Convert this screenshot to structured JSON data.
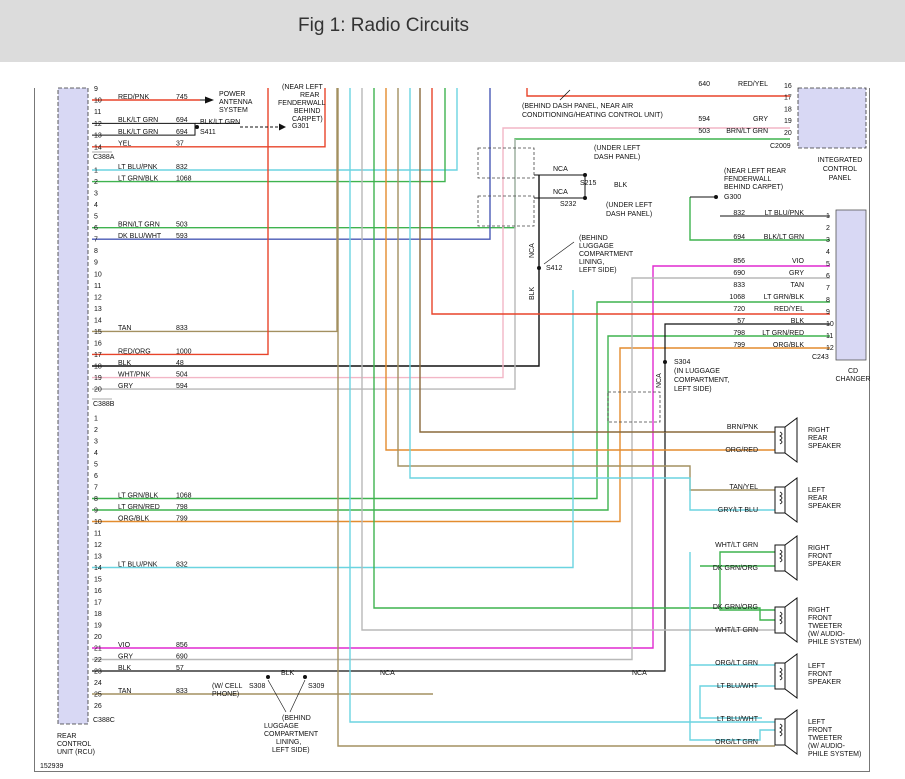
{
  "title": "Fig 1: Radio Circuits",
  "figure_id": "152939",
  "colors": {
    "connector_fill": "#d8d8f4",
    "wire_red": "#e8442a",
    "wire_green": "#3fb34f",
    "wire_cyan": "#6bd4e0",
    "wire_blue": "#4a5ab6",
    "wire_olive": "#a39060",
    "wire_orange": "#e38c2e",
    "wire_magenta": "#e02ad0",
    "wire_pink": "#f2b6c6",
    "wire_gray": "#b8b8b8",
    "wire_black": "#111111",
    "wire_brown": "#8a6a3c"
  },
  "rcu": {
    "label_1": "REAR",
    "label_2": "CONTROL",
    "label_3": "UNIT (RCU)",
    "connectors": [
      "C388A",
      "C388B",
      "C388C"
    ]
  },
  "rcu_a_pins": [
    {
      "pin": "9",
      "color": "",
      "circuit": ""
    },
    {
      "pin": "10",
      "color": "RED/PNK",
      "circuit": "745"
    },
    {
      "pin": "11",
      "color": "",
      "circuit": ""
    },
    {
      "pin": "12",
      "color": "BLK/LT GRN",
      "circuit": "694"
    },
    {
      "pin": "13",
      "color": "BLK/LT GRN",
      "circuit": "694"
    },
    {
      "pin": "14",
      "color": "YEL",
      "circuit": "37"
    }
  ],
  "rcu_b_pins": [
    {
      "pin": "1",
      "color": "LT BLU/PNK",
      "circuit": "832"
    },
    {
      "pin": "2",
      "color": "LT GRN/BLK",
      "circuit": "1068"
    },
    {
      "pin": "3",
      "color": "",
      "circuit": ""
    },
    {
      "pin": "4",
      "color": "",
      "circuit": ""
    },
    {
      "pin": "5",
      "color": "",
      "circuit": ""
    },
    {
      "pin": "6",
      "color": "BRN/LT GRN",
      "circuit": "503"
    },
    {
      "pin": "7",
      "color": "DK BLU/WHT",
      "circuit": "593"
    },
    {
      "pin": "8",
      "color": "",
      "circuit": ""
    },
    {
      "pin": "9",
      "color": "",
      "circuit": ""
    },
    {
      "pin": "10",
      "color": "",
      "circuit": ""
    },
    {
      "pin": "11",
      "color": "",
      "circuit": ""
    },
    {
      "pin": "12",
      "color": "",
      "circuit": ""
    },
    {
      "pin": "13",
      "color": "",
      "circuit": ""
    },
    {
      "pin": "14",
      "color": "",
      "circuit": ""
    },
    {
      "pin": "15",
      "color": "TAN",
      "circuit": "833"
    },
    {
      "pin": "16",
      "color": "",
      "circuit": ""
    },
    {
      "pin": "17",
      "color": "RED/ORG",
      "circuit": "1000"
    },
    {
      "pin": "18",
      "color": "BLK",
      "circuit": "48"
    },
    {
      "pin": "19",
      "color": "WHT/PNK",
      "circuit": "504"
    },
    {
      "pin": "20",
      "color": "GRY",
      "circuit": "594"
    }
  ],
  "rcu_c_pins": [
    {
      "pin": "1",
      "color": "",
      "circuit": ""
    },
    {
      "pin": "2",
      "color": "",
      "circuit": ""
    },
    {
      "pin": "3",
      "color": "",
      "circuit": ""
    },
    {
      "pin": "4",
      "color": "",
      "circuit": ""
    },
    {
      "pin": "5",
      "color": "",
      "circuit": ""
    },
    {
      "pin": "6",
      "color": "",
      "circuit": ""
    },
    {
      "pin": "7",
      "color": "",
      "circuit": ""
    },
    {
      "pin": "8",
      "color": "LT GRN/BLK",
      "circuit": "1068"
    },
    {
      "pin": "9",
      "color": "LT GRN/RED",
      "circuit": "798"
    },
    {
      "pin": "10",
      "color": "ORG/BLK",
      "circuit": "799"
    },
    {
      "pin": "11",
      "color": "",
      "circuit": ""
    },
    {
      "pin": "12",
      "color": "",
      "circuit": ""
    },
    {
      "pin": "13",
      "color": "",
      "circuit": ""
    },
    {
      "pin": "14",
      "color": "LT BLU/PNK",
      "circuit": "832"
    },
    {
      "pin": "15",
      "color": "",
      "circuit": ""
    },
    {
      "pin": "16",
      "color": "",
      "circuit": ""
    },
    {
      "pin": "17",
      "color": "",
      "circuit": ""
    },
    {
      "pin": "18",
      "color": "",
      "circuit": ""
    },
    {
      "pin": "19",
      "color": "",
      "circuit": ""
    },
    {
      "pin": "20",
      "color": "",
      "circuit": ""
    },
    {
      "pin": "21",
      "color": "VIO",
      "circuit": "856"
    },
    {
      "pin": "22",
      "color": "GRY",
      "circuit": "690"
    },
    {
      "pin": "23",
      "color": "BLK",
      "circuit": "57"
    },
    {
      "pin": "24",
      "color": "",
      "circuit": ""
    },
    {
      "pin": "25",
      "color": "TAN",
      "circuit": "833"
    },
    {
      "pin": "26",
      "color": "",
      "circuit": ""
    }
  ],
  "antenna": {
    "line1": "POWER",
    "line2": "ANTENNA",
    "line3": "SYSTEM"
  },
  "s411": {
    "label": "S411",
    "color": "BLK/LT GRN"
  },
  "g301": {
    "label": "G301",
    "note1": "(NEAR LEFT",
    "note2": "REAR",
    "note3": "FENDERWALL",
    "note4": "BEHIND",
    "note5": "CARPET)"
  },
  "icp": {
    "connector": "C2009",
    "label1": "INTEGRATED",
    "label2": "CONTROL",
    "label3": "PANEL",
    "pins": [
      {
        "pin": "16",
        "color": "RED/YEL",
        "circuit": "640"
      },
      {
        "pin": "17",
        "color": "",
        "circuit": ""
      },
      {
        "pin": "18",
        "color": "",
        "circuit": ""
      },
      {
        "pin": "19",
        "color": "GRY",
        "circuit": "594"
      },
      {
        "pin": "20",
        "color": "BRN/LT GRN",
        "circuit": "503"
      }
    ],
    "note1": "(BEHIND DASH PANEL, NEAR AIR",
    "note2": "CONDITIONING/HEATING CONTROL UNIT)"
  },
  "splices": {
    "s215": {
      "label": "S215",
      "nca": "NCA",
      "note1": "(UNDER LEFT",
      "note2": "DASH PANEL)",
      "wire": "BLK"
    },
    "s232": {
      "label": "S232",
      "nca": "NCA",
      "note1": "(UNDER LEFT",
      "note2": "DASH PANEL)"
    },
    "s412": {
      "label": "S412",
      "nca": "NCA",
      "wire": "BLK",
      "note1": "(BEHIND",
      "note2": "LUGGAGE",
      "note3": "COMPARTMENT",
      "note4": "LINING,",
      "note5": "LEFT SIDE)"
    },
    "s304": {
      "label": "S304",
      "nca": "NCA",
      "note1": "(IN LUGGAGE",
      "note2": "COMPARTMENT,",
      "note3": "LEFT SIDE)"
    },
    "s308": {
      "label": "S308",
      "note1": "(W/ CELL",
      "note2": "PHONE)"
    },
    "s309": {
      "label": "S309",
      "wire": "BLK",
      "nca1": "NCA",
      "nca2": "NCA",
      "note1": "(BEHIND",
      "note2": "LUGGAGE",
      "note3": "COMPARTMENT",
      "note4": "LINING,",
      "note5": "LEFT SIDE)"
    }
  },
  "g300": {
    "label": "G300",
    "note1": "(NEAR LEFT REAR",
    "note2": "FENDERWALL",
    "note3": "BEHIND CARPET)"
  },
  "cd": {
    "connector": "C243",
    "label1": "CD",
    "label2": "CHANGER",
    "pins": [
      {
        "pin": "1",
        "color": "LT BLU/PNK",
        "circuit": "832"
      },
      {
        "pin": "2",
        "color": "",
        "circuit": ""
      },
      {
        "pin": "3",
        "color": "BLK/LT GRN",
        "circuit": "694"
      },
      {
        "pin": "4",
        "color": "",
        "circuit": ""
      },
      {
        "pin": "5",
        "color": "VIO",
        "circuit": "856"
      },
      {
        "pin": "6",
        "color": "GRY",
        "circuit": "690"
      },
      {
        "pin": "7",
        "color": "TAN",
        "circuit": "833"
      },
      {
        "pin": "8",
        "color": "LT GRN/BLK",
        "circuit": "1068"
      },
      {
        "pin": "9",
        "color": "RED/YEL",
        "circuit": "720"
      },
      {
        "pin": "10",
        "color": "BLK",
        "circuit": "57"
      },
      {
        "pin": "11",
        "color": "LT GRN/RED",
        "circuit": "798"
      },
      {
        "pin": "12",
        "color": "ORG/BLK",
        "circuit": "799"
      }
    ]
  },
  "speakers": [
    {
      "line1": "RIGHT",
      "line2": "REAR",
      "line3": "SPEAKER",
      "line4": "",
      "wire1": "BRN/PNK",
      "wire2": "ORG/RED"
    },
    {
      "line1": "LEFT",
      "line2": "REAR",
      "line3": "SPEAKER",
      "line4": "",
      "wire1": "TAN/YEL",
      "wire2": "GRY/LT BLU"
    },
    {
      "line1": "RIGHT",
      "line2": "FRONT",
      "line3": "SPEAKER",
      "line4": "",
      "wire1": "WHT/LT GRN",
      "wire2": "DK GRN/ORG"
    },
    {
      "line1": "RIGHT",
      "line2": "FRONT",
      "line3": "TWEETER",
      "line4": "(W/ AUDIO-",
      "line5": "PHILE SYSTEM)",
      "wire1": "DK GRN/ORG",
      "wire2": "WHT/LT GRN"
    },
    {
      "line1": "LEFT",
      "line2": "FRONT",
      "line3": "SPEAKER",
      "line4": "",
      "wire1": "ORG/LT GRN",
      "wire2": "LT BLU/WHT"
    },
    {
      "line1": "LEFT",
      "line2": "FRONT",
      "line3": "TWEETER",
      "line4": "(W/ AUDIO-",
      "line5": "PHILE SYSTEM)",
      "wire1": "LT BLU/WHT",
      "wire2": "ORG/LT GRN"
    }
  ]
}
